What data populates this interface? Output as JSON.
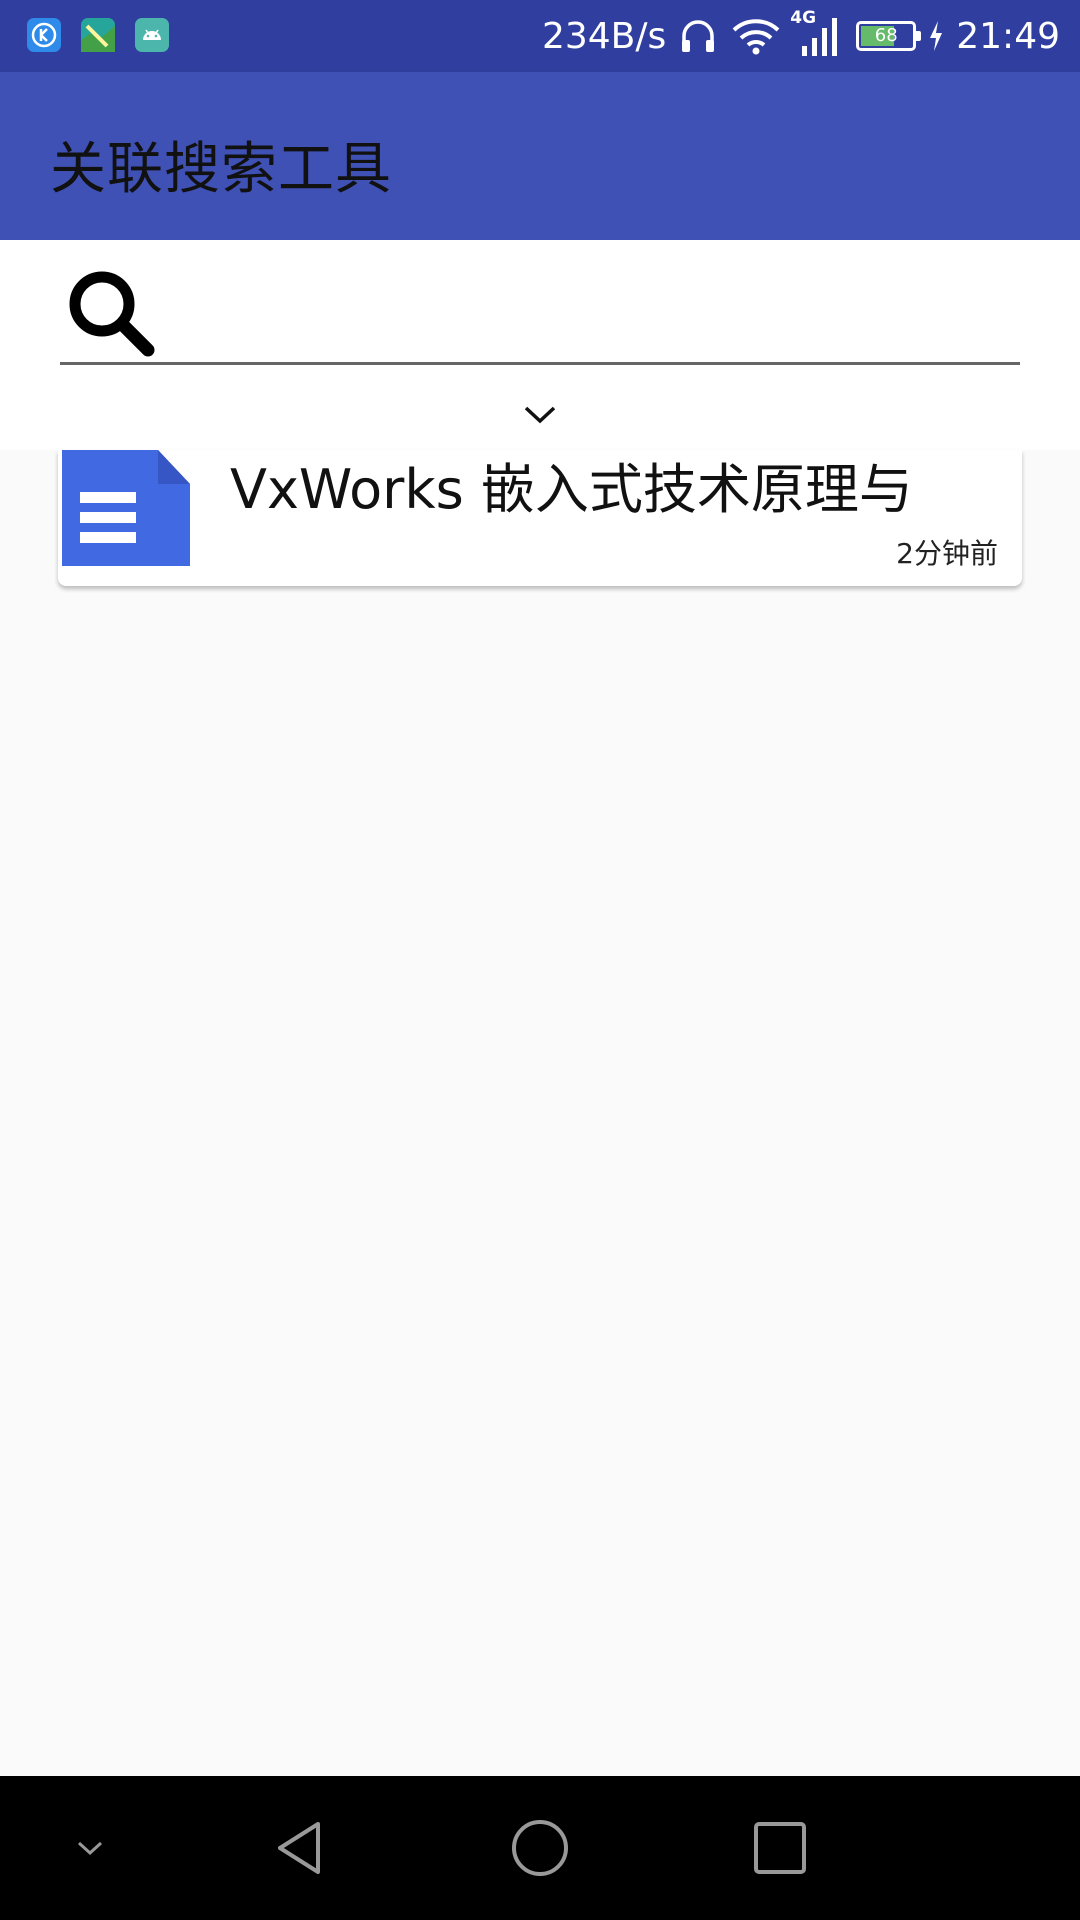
{
  "status_bar": {
    "net_speed": "234B/s",
    "network_type": "4G",
    "battery_level": "68",
    "battery_fraction": 0.68,
    "time": "21:49",
    "icons": [
      "kugou-app-icon",
      "maps-app-icon",
      "android-app-icon",
      "headphones-icon",
      "wifi-icon",
      "signal-icon",
      "battery-icon",
      "charging-icon"
    ]
  },
  "app_bar": {
    "title": "关联搜索工具"
  },
  "search": {
    "value": "",
    "placeholder": ""
  },
  "results": [
    {
      "title": "VxWorks 嵌入式技术原理与",
      "time": "2分钟前",
      "icon": "document-icon"
    }
  ],
  "colors": {
    "status_bar": "#303f9f",
    "app_bar": "#3f51b5",
    "doc_icon": "#4169e1",
    "background": "#fafafa",
    "nav_bar": "#000000"
  }
}
